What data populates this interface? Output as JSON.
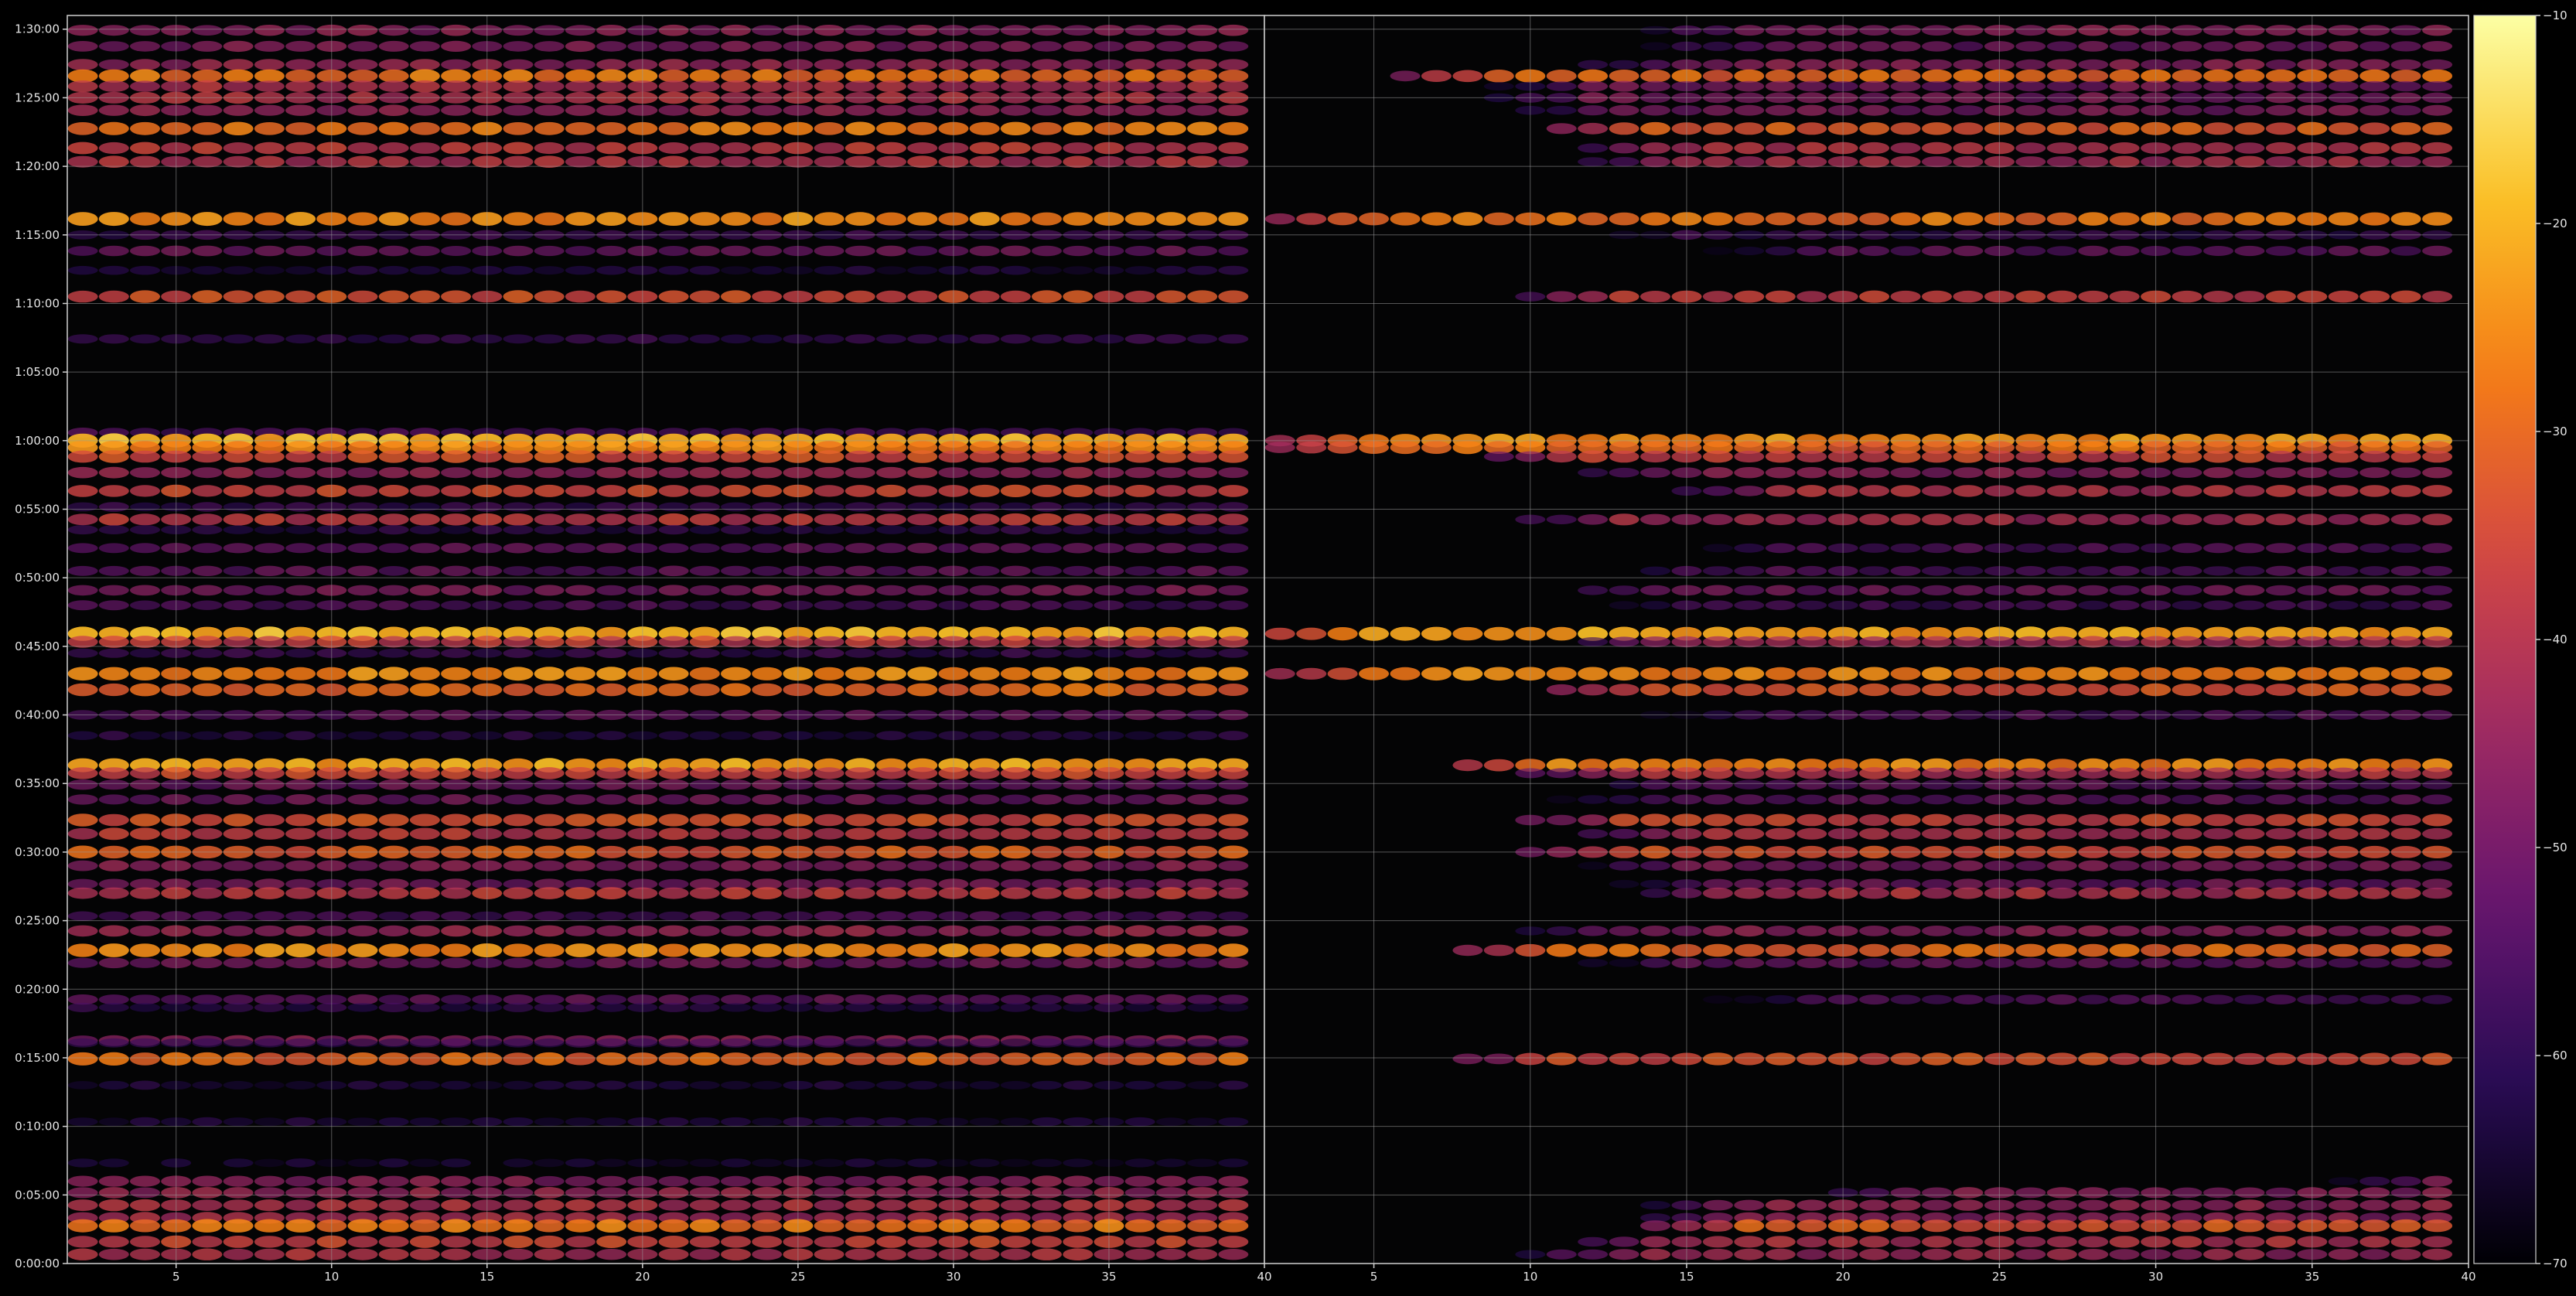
{
  "chart_data": [
    {
      "type": "heatmap",
      "panel": "left",
      "title": "",
      "xlabel": "",
      "ylabel": "",
      "xlim": [
        1.5,
        40
      ],
      "ylim": [
        0,
        5460
      ],
      "x_ticks": [
        5,
        10,
        15,
        20,
        25,
        30,
        35,
        40
      ],
      "x_tick_labels": [
        "5",
        "10",
        "15",
        "20",
        "25",
        "30",
        "35",
        "40"
      ],
      "y_ticks": [
        0,
        300,
        600,
        900,
        1200,
        1500,
        1800,
        2100,
        2400,
        2700,
        3000,
        3300,
        3600,
        3900,
        4200,
        4500,
        4800,
        5100,
        5400
      ],
      "y_tick_labels": [
        "0:00:00",
        "0:05:00",
        "0:10:00",
        "0:15:00",
        "0:20:00",
        "0:25:00",
        "0:30:00",
        "0:35:00",
        "0:40:00",
        "0:45:00",
        "0:50:00",
        "0:55:00",
        "1:00:00",
        "1:05:00",
        "1:10:00",
        "1:15:00",
        "1:20:00",
        "1:25:00",
        "1:30:00"
      ],
      "grid": true,
      "bands": [
        {
          "t": 5395,
          "db": -46
        },
        {
          "t": 5325,
          "db": -47
        },
        {
          "t": 5245,
          "db": -44
        },
        {
          "t": 5195,
          "db": -28
        },
        {
          "t": 5150,
          "db": -40
        },
        {
          "t": 5100,
          "db": -40
        },
        {
          "t": 5045,
          "db": -44
        },
        {
          "t": 4965,
          "db": -28
        },
        {
          "t": 4880,
          "db": -38
        },
        {
          "t": 4820,
          "db": -40
        },
        {
          "t": 4570,
          "db": -25
        },
        {
          "t": 4500,
          "db": -57
        },
        {
          "t": 4430,
          "db": -50
        },
        {
          "t": 4345,
          "db": -62
        },
        {
          "t": 4230,
          "db": -34
        },
        {
          "t": 4045,
          "db": -58
        },
        {
          "t": 3635,
          "db": -55
        },
        {
          "t": 3600,
          "db": -20
        },
        {
          "t": 3570,
          "db": -26
        },
        {
          "t": 3530,
          "db": -34
        },
        {
          "t": 3460,
          "db": -44
        },
        {
          "t": 3380,
          "db": -36
        },
        {
          "t": 3310,
          "db": -58
        },
        {
          "t": 3255,
          "db": -38
        },
        {
          "t": 3210,
          "db": -60
        },
        {
          "t": 3130,
          "db": -52
        },
        {
          "t": 3030,
          "db": -52
        },
        {
          "t": 2945,
          "db": -48
        },
        {
          "t": 2880,
          "db": -55
        },
        {
          "t": 2755,
          "db": -20
        },
        {
          "t": 2720,
          "db": -38
        },
        {
          "t": 2670,
          "db": -58
        },
        {
          "t": 2580,
          "db": -25
        },
        {
          "t": 2510,
          "db": -30
        },
        {
          "t": 2400,
          "db": -52
        },
        {
          "t": 2310,
          "db": -60
        },
        {
          "t": 2180,
          "db": -22
        },
        {
          "t": 2145,
          "db": -36
        },
        {
          "t": 2095,
          "db": -50
        },
        {
          "t": 2030,
          "db": -50
        },
        {
          "t": 1940,
          "db": -34
        },
        {
          "t": 1880,
          "db": -38
        },
        {
          "t": 1800,
          "db": -32
        },
        {
          "t": 1740,
          "db": -46
        },
        {
          "t": 1660,
          "db": -48
        },
        {
          "t": 1620,
          "db": -38
        },
        {
          "t": 1520,
          "db": -55
        },
        {
          "t": 1455,
          "db": -44
        },
        {
          "t": 1370,
          "db": -25
        },
        {
          "t": 1315,
          "db": -50
        },
        {
          "t": 1155,
          "db": -52
        },
        {
          "t": 1120,
          "db": -60
        },
        {
          "t": 975,
          "db": -46
        },
        {
          "t": 965,
          "db": -60
        },
        {
          "t": 895,
          "db": -30
        },
        {
          "t": 780,
          "db": -62
        },
        {
          "t": 620,
          "db": -62
        },
        {
          "t": 440,
          "db": -64
        },
        {
          "t": 360,
          "db": -46
        },
        {
          "t": 310,
          "db": -44
        },
        {
          "t": 255,
          "db": -40
        },
        {
          "t": 200,
          "db": -42
        },
        {
          "t": 165,
          "db": -28
        },
        {
          "t": 95,
          "db": -36
        },
        {
          "t": 40,
          "db": -40
        }
      ]
    },
    {
      "type": "heatmap",
      "panel": "right",
      "title": "",
      "xlabel": "",
      "ylabel": "",
      "xlim": [
        1.5,
        40
      ],
      "ylim": [
        0,
        5460
      ],
      "x_ticks": [
        5,
        10,
        15,
        20,
        25,
        30,
        35,
        40
      ],
      "x_tick_labels": [
        "5",
        "10",
        "15",
        "20",
        "25",
        "30",
        "35",
        "40"
      ],
      "grid": true,
      "bands": [
        {
          "t": 5395,
          "db": -46,
          "start": 14
        },
        {
          "t": 5325,
          "db": -50,
          "start": 14
        },
        {
          "t": 5245,
          "db": -46,
          "start": 12
        },
        {
          "t": 5195,
          "db": -30,
          "start": 6
        },
        {
          "t": 5150,
          "db": -48,
          "start": 9
        },
        {
          "t": 5100,
          "db": -48,
          "start": 9
        },
        {
          "t": 5045,
          "db": -48,
          "start": 10
        },
        {
          "t": 4965,
          "db": -32,
          "start": 11
        },
        {
          "t": 4880,
          "db": -40,
          "start": 12
        },
        {
          "t": 4820,
          "db": -42,
          "start": 12
        },
        {
          "t": 4570,
          "db": -28,
          "start": 2
        },
        {
          "t": 4500,
          "db": -58,
          "start": 12
        },
        {
          "t": 4430,
          "db": -52,
          "start": 16
        },
        {
          "t": 4230,
          "db": -38,
          "start": 10
        },
        {
          "t": 3600,
          "db": -24,
          "start": 2
        },
        {
          "t": 3570,
          "db": -30,
          "start": 2
        },
        {
          "t": 3530,
          "db": -36,
          "start": 9
        },
        {
          "t": 3460,
          "db": -46,
          "start": 12
        },
        {
          "t": 3380,
          "db": -40,
          "start": 15
        },
        {
          "t": 3255,
          "db": -42,
          "start": 10
        },
        {
          "t": 3130,
          "db": -54,
          "start": 15
        },
        {
          "t": 3030,
          "db": -54,
          "start": 12
        },
        {
          "t": 2945,
          "db": -50,
          "start": 11
        },
        {
          "t": 2880,
          "db": -56,
          "start": 12
        },
        {
          "t": 2755,
          "db": -22,
          "start": 2
        },
        {
          "t": 2720,
          "db": -42,
          "start": 12
        },
        {
          "t": 2580,
          "db": -26,
          "start": 2
        },
        {
          "t": 2510,
          "db": -32,
          "start": 11
        },
        {
          "t": 2400,
          "db": -54,
          "start": 14
        },
        {
          "t": 2180,
          "db": -26,
          "start": 8
        },
        {
          "t": 2145,
          "db": -40,
          "start": 10
        },
        {
          "t": 2095,
          "db": -52,
          "start": 12
        },
        {
          "t": 2030,
          "db": -52,
          "start": 11
        },
        {
          "t": 1940,
          "db": -36,
          "start": 10
        },
        {
          "t": 1880,
          "db": -40,
          "start": 12
        },
        {
          "t": 1800,
          "db": -34,
          "start": 10
        },
        {
          "t": 1740,
          "db": -48,
          "start": 12
        },
        {
          "t": 1660,
          "db": -50,
          "start": 13
        },
        {
          "t": 1620,
          "db": -40,
          "start": 14
        },
        {
          "t": 1455,
          "db": -46,
          "start": 10
        },
        {
          "t": 1370,
          "db": -30,
          "start": 8
        },
        {
          "t": 1315,
          "db": -52,
          "start": 12
        },
        {
          "t": 1155,
          "db": -54,
          "start": 16
        },
        {
          "t": 895,
          "db": -34,
          "start": 8
        },
        {
          "t": 360,
          "db": -48,
          "start": 36
        },
        {
          "t": 310,
          "db": -46,
          "start": 20
        },
        {
          "t": 255,
          "db": -44,
          "start": 14
        },
        {
          "t": 200,
          "db": -46,
          "start": 14
        },
        {
          "t": 165,
          "db": -32,
          "start": 14
        },
        {
          "t": 95,
          "db": -40,
          "start": 12
        },
        {
          "t": 40,
          "db": -44,
          "start": 10
        }
      ]
    }
  ],
  "colorbar": {
    "cmap": "inferno",
    "range": [
      -70,
      -10
    ],
    "ticks": [
      -10,
      -20,
      -30,
      -40,
      -50,
      -60,
      -70
    ],
    "tick_labels": [
      "−10",
      "−20",
      "−30",
      "−40",
      "−50",
      "−60",
      "−70"
    ]
  },
  "colors": {
    "background": "#000000",
    "axes_face": "#040405",
    "spine": "#d0d0d0",
    "grid": "#9a9a9a",
    "text": "#e6e6e6"
  }
}
